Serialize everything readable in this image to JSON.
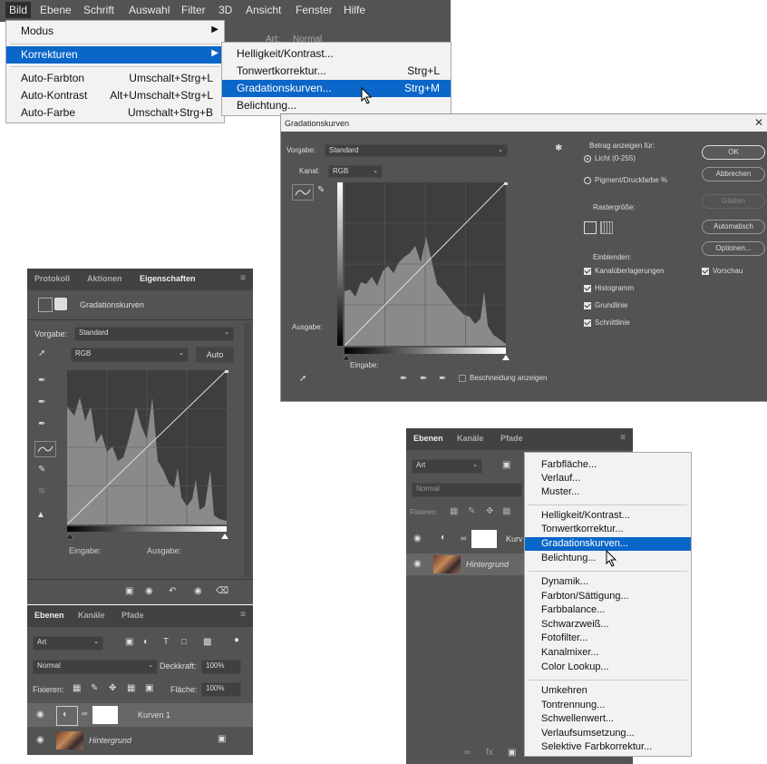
{
  "menubar": {
    "items": [
      "Bild",
      "Ebene",
      "Schrift",
      "Auswahl",
      "Filter",
      "3D",
      "Ansicht",
      "Fenster",
      "Hilfe"
    ],
    "bg_text": [
      "Art:",
      "Normal"
    ]
  },
  "bild_menu": {
    "items": [
      {
        "label": "Modus",
        "shortcut": "",
        "submenu": true
      },
      {
        "label": "Korrekturen",
        "shortcut": "",
        "submenu": true
      },
      {
        "label": "Auto-Farbton",
        "shortcut": "Umschalt+Strg+L"
      },
      {
        "label": "Auto-Kontrast",
        "shortcut": "Alt+Umschalt+Strg+L"
      },
      {
        "label": "Auto-Farbe",
        "shortcut": "Umschalt+Strg+B"
      }
    ]
  },
  "korrekturen_menu": {
    "items": [
      {
        "label": "Helligkeit/Kontrast...",
        "shortcut": ""
      },
      {
        "label": "Tonwertkorrektur...",
        "shortcut": "Strg+L"
      },
      {
        "label": "Gradationskurven...",
        "shortcut": "Strg+M"
      },
      {
        "label": "Belichtung...",
        "shortcut": ""
      }
    ]
  },
  "dialog": {
    "title": "Gradationskurven",
    "preset_label": "Vorgabe:",
    "preset_value": "Standard",
    "channel_label": "Kanal:",
    "channel_value": "RGB",
    "output_label": "Ausgabe:",
    "input_label": "Eingabe:",
    "show_clipping": "Beschneidung anzeigen",
    "display_amount_label": "Betrag anzeigen für:",
    "light_option": "Licht (0-255)",
    "pigment_option": "Pigment/Druckfarbe %",
    "grid_size_label": "Rastergröße:",
    "show_label": "Einblenden:",
    "show_options": [
      "Kanalüberlagerungen",
      "Histogramm",
      "Grundlinie",
      "Schnittlinie"
    ],
    "buttons": {
      "ok": "OK",
      "cancel": "Abbrechen",
      "smooth": "Glätten",
      "auto": "Automatisch",
      "options": "Optionen..."
    },
    "preview": "Vorschau"
  },
  "properties": {
    "tabs": [
      "Protokoll",
      "Aktionen",
      "Eigenschaften"
    ],
    "header": "Gradationskurven",
    "preset_label": "Vorgabe:",
    "preset_value": "Standard",
    "channel_value": "RGB",
    "auto_button": "Auto",
    "input_label": "Eingabe:",
    "output_label": "Ausgabe:"
  },
  "layers_left": {
    "tabs": [
      "Ebenen",
      "Kanäle",
      "Pfade"
    ],
    "filter_value": "Art",
    "blend_mode": "Normal",
    "opacity_label": "Deckkraft:",
    "opacity_value": "100%",
    "lock_label": "Fixieren:",
    "fill_label": "Fläche:",
    "fill_value": "100%",
    "layers": [
      {
        "name": "Kurven 1"
      },
      {
        "name": "Hintergrund"
      }
    ]
  },
  "layers_right": {
    "tabs": [
      "Ebenen",
      "Kanäle",
      "Pfade"
    ],
    "filter_value": "Art",
    "blend_mode": "Normal",
    "lock_label": "Fixieren:",
    "layers": [
      {
        "name": "Kurv"
      },
      {
        "name": "Hintergrund"
      }
    ]
  },
  "adjust_menu": {
    "groups": [
      [
        "Farbfläche...",
        "Verlauf...",
        "Muster..."
      ],
      [
        "Helligkeit/Kontrast...",
        "Tonwertkorrektur...",
        "Gradationskurven...",
        "Belichtung..."
      ],
      [
        "Dynamik...",
        "Farbton/Sättigung...",
        "Farbbalance...",
        "Schwarzweiß...",
        "Fotofilter...",
        "Kanalmixer...",
        "Color Lookup..."
      ],
      [
        "Umkehren",
        "Tontrennung...",
        "Schwellenwert...",
        "Verlaufsumsetzung...",
        "Selektive Farbkorrektur..."
      ]
    ],
    "selected": "Gradationskurven..."
  },
  "colors": {
    "menu_highlight": "#0a66c8",
    "panel_bg": "#535353",
    "panel_dark": "#424242",
    "menu_bg": "#f2f2f2"
  }
}
